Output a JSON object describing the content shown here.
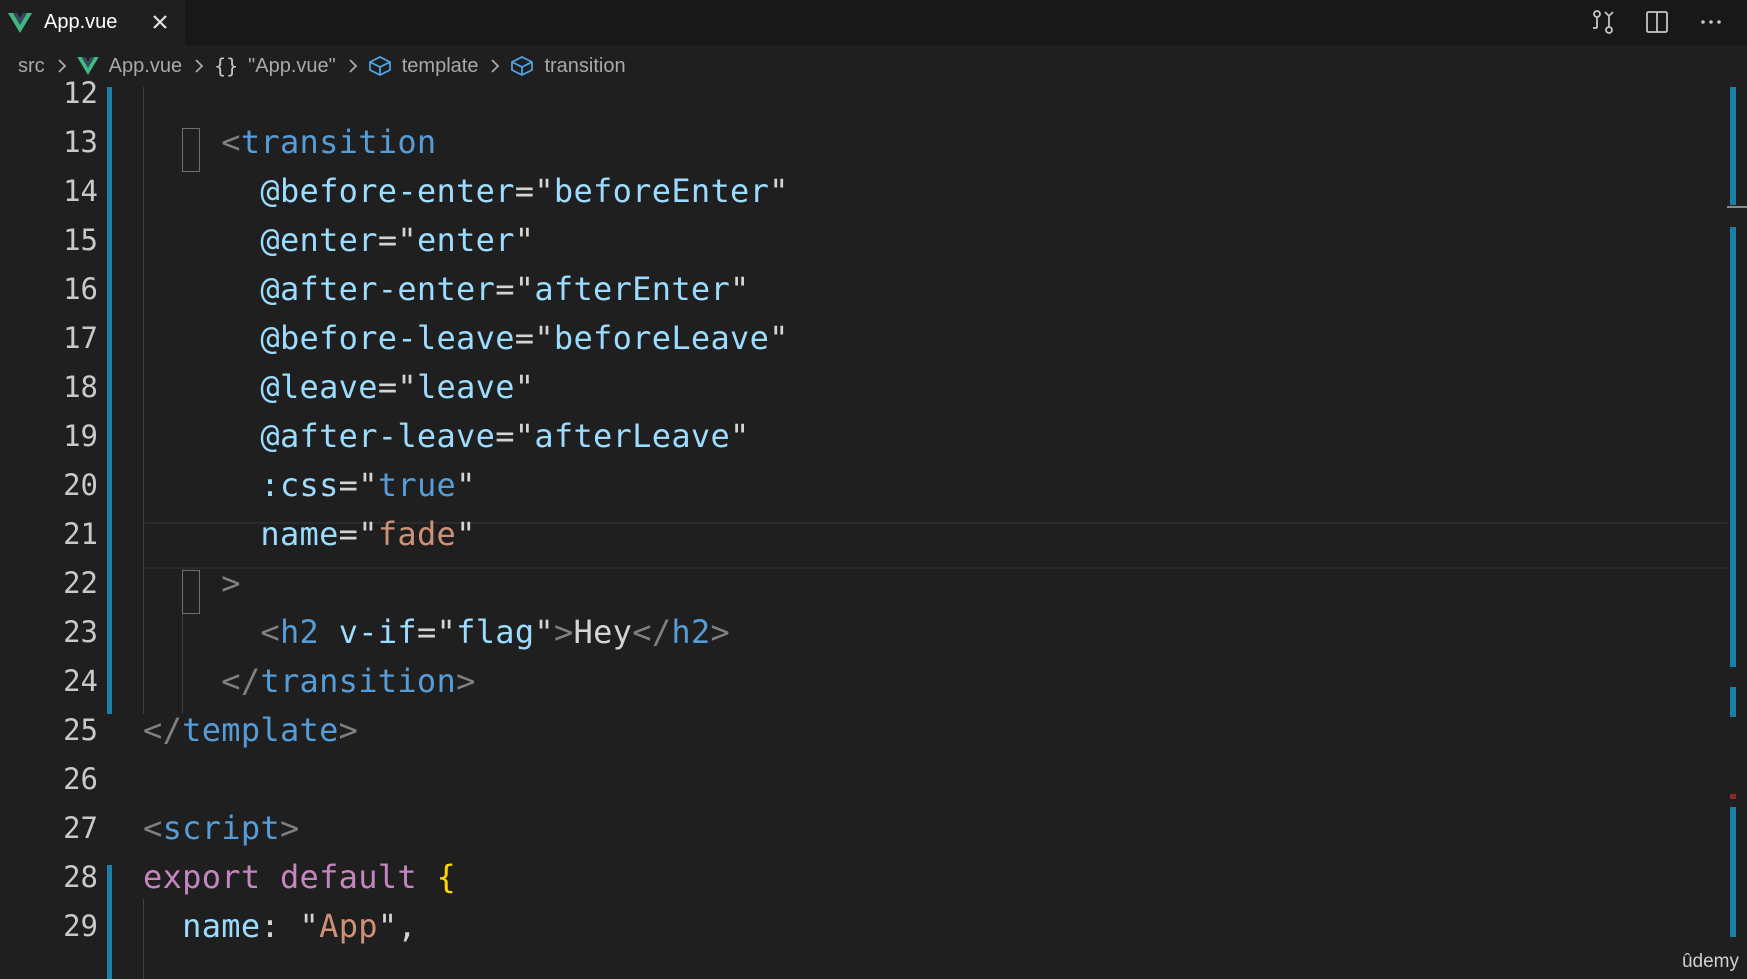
{
  "tab": {
    "label": "App.vue",
    "icon": "vue-logo-icon",
    "close_icon": "close-icon"
  },
  "tab_actions": [
    "source-control-compare-icon",
    "split-editor-icon",
    "more-actions-icon"
  ],
  "breadcrumb": {
    "items": [
      {
        "label": "src",
        "icon": ""
      },
      {
        "label": "App.vue",
        "icon": "vue-logo-icon"
      },
      {
        "label": "\"App.vue\"",
        "icon": "braces-icon"
      },
      {
        "label": "template",
        "icon": "cube-icon"
      },
      {
        "label": "transition",
        "icon": "cube-icon"
      }
    ]
  },
  "editor": {
    "lines": [
      {
        "number": "12",
        "tokens": []
      },
      {
        "number": "13",
        "tokens": [
          {
            "t": "    ",
            "c": "text"
          },
          {
            "t": "<",
            "c": "punct"
          },
          {
            "t": "transition",
            "c": "tag"
          }
        ]
      },
      {
        "number": "14",
        "tokens": [
          {
            "t": "      ",
            "c": "text"
          },
          {
            "t": "@before-enter",
            "c": "attr"
          },
          {
            "t": "=",
            "c": "eq"
          },
          {
            "t": "\"beforeEnter\"",
            "c": "attr-val"
          }
        ]
      },
      {
        "number": "15",
        "tokens": [
          {
            "t": "      ",
            "c": "text"
          },
          {
            "t": "@enter",
            "c": "attr"
          },
          {
            "t": "=",
            "c": "eq"
          },
          {
            "t": "\"enter\"",
            "c": "attr-val"
          }
        ]
      },
      {
        "number": "16",
        "tokens": [
          {
            "t": "      ",
            "c": "text"
          },
          {
            "t": "@after-enter",
            "c": "attr"
          },
          {
            "t": "=",
            "c": "eq"
          },
          {
            "t": "\"afterEnter\"",
            "c": "attr-val"
          }
        ]
      },
      {
        "number": "17",
        "tokens": [
          {
            "t": "      ",
            "c": "text"
          },
          {
            "t": "@before-leave",
            "c": "attr"
          },
          {
            "t": "=",
            "c": "eq"
          },
          {
            "t": "\"beforeLeave\"",
            "c": "attr-val"
          }
        ]
      },
      {
        "number": "18",
        "tokens": [
          {
            "t": "      ",
            "c": "text"
          },
          {
            "t": "@leave",
            "c": "attr"
          },
          {
            "t": "=",
            "c": "eq"
          },
          {
            "t": "\"leave\"",
            "c": "attr-val"
          }
        ]
      },
      {
        "number": "19",
        "tokens": [
          {
            "t": "      ",
            "c": "text"
          },
          {
            "t": "@after-leave",
            "c": "attr"
          },
          {
            "t": "=",
            "c": "eq"
          },
          {
            "t": "\"afterLeave\"",
            "c": "attr-val"
          }
        ]
      },
      {
        "number": "20",
        "tokens": [
          {
            "t": "      ",
            "c": "text"
          },
          {
            "t": ":css",
            "c": "attr"
          },
          {
            "t": "=",
            "c": "eq"
          },
          {
            "t": "\"",
            "c": "eq"
          },
          {
            "t": "true",
            "c": "tag"
          },
          {
            "t": "\"",
            "c": "eq"
          }
        ]
      },
      {
        "number": "21",
        "tokens": [
          {
            "t": "      ",
            "c": "text"
          },
          {
            "t": "name",
            "c": "attr"
          },
          {
            "t": "=",
            "c": "eq"
          },
          {
            "t": "\"fade\"",
            "c": "str"
          }
        ]
      },
      {
        "number": "22",
        "tokens": [
          {
            "t": "    ",
            "c": "text"
          },
          {
            "t": ">",
            "c": "punct"
          }
        ]
      },
      {
        "number": "23",
        "tokens": [
          {
            "t": "      ",
            "c": "text"
          },
          {
            "t": "<",
            "c": "punct"
          },
          {
            "t": "h2",
            "c": "tag"
          },
          {
            "t": " ",
            "c": "text"
          },
          {
            "t": "v-if",
            "c": "attr"
          },
          {
            "t": "=",
            "c": "eq"
          },
          {
            "t": "\"flag\"",
            "c": "attr-val"
          },
          {
            "t": ">",
            "c": "punct"
          },
          {
            "t": "Hey",
            "c": "text"
          },
          {
            "t": "</",
            "c": "punct"
          },
          {
            "t": "h2",
            "c": "tag"
          },
          {
            "t": ">",
            "c": "punct"
          }
        ]
      },
      {
        "number": "24",
        "tokens": [
          {
            "t": "    ",
            "c": "text"
          },
          {
            "t": "</",
            "c": "punct"
          },
          {
            "t": "transition",
            "c": "tag"
          },
          {
            "t": ">",
            "c": "punct"
          }
        ]
      },
      {
        "number": "25",
        "tokens": [
          {
            "t": "</",
            "c": "punct"
          },
          {
            "t": "template",
            "c": "tag"
          },
          {
            "t": ">",
            "c": "punct"
          }
        ]
      },
      {
        "number": "26",
        "tokens": []
      },
      {
        "number": "27",
        "tokens": [
          {
            "t": "<",
            "c": "punct"
          },
          {
            "t": "script",
            "c": "tag"
          },
          {
            "t": ">",
            "c": "punct"
          }
        ]
      },
      {
        "number": "28",
        "tokens": [
          {
            "t": "export",
            "c": "kw"
          },
          {
            "t": " ",
            "c": "text"
          },
          {
            "t": "default",
            "c": "kw"
          },
          {
            "t": " ",
            "c": "text"
          },
          {
            "t": "{",
            "c": "brace"
          }
        ]
      },
      {
        "number": "29",
        "tokens": [
          {
            "t": "  ",
            "c": "text"
          },
          {
            "t": "name",
            "c": "prop"
          },
          {
            "t": ": ",
            "c": "text"
          },
          {
            "t": "\"App\"",
            "c": "str"
          },
          {
            "t": ",",
            "c": "text"
          }
        ]
      }
    ]
  },
  "watermark": "ûdemy",
  "colors": {
    "background": "#1f1f1f",
    "tag": "#569cd6",
    "attribute": "#9cdcfe",
    "string": "#ce9178",
    "keyword": "#c586c0",
    "punctuation": "#808080",
    "modified_bar": "#1b81a8"
  }
}
